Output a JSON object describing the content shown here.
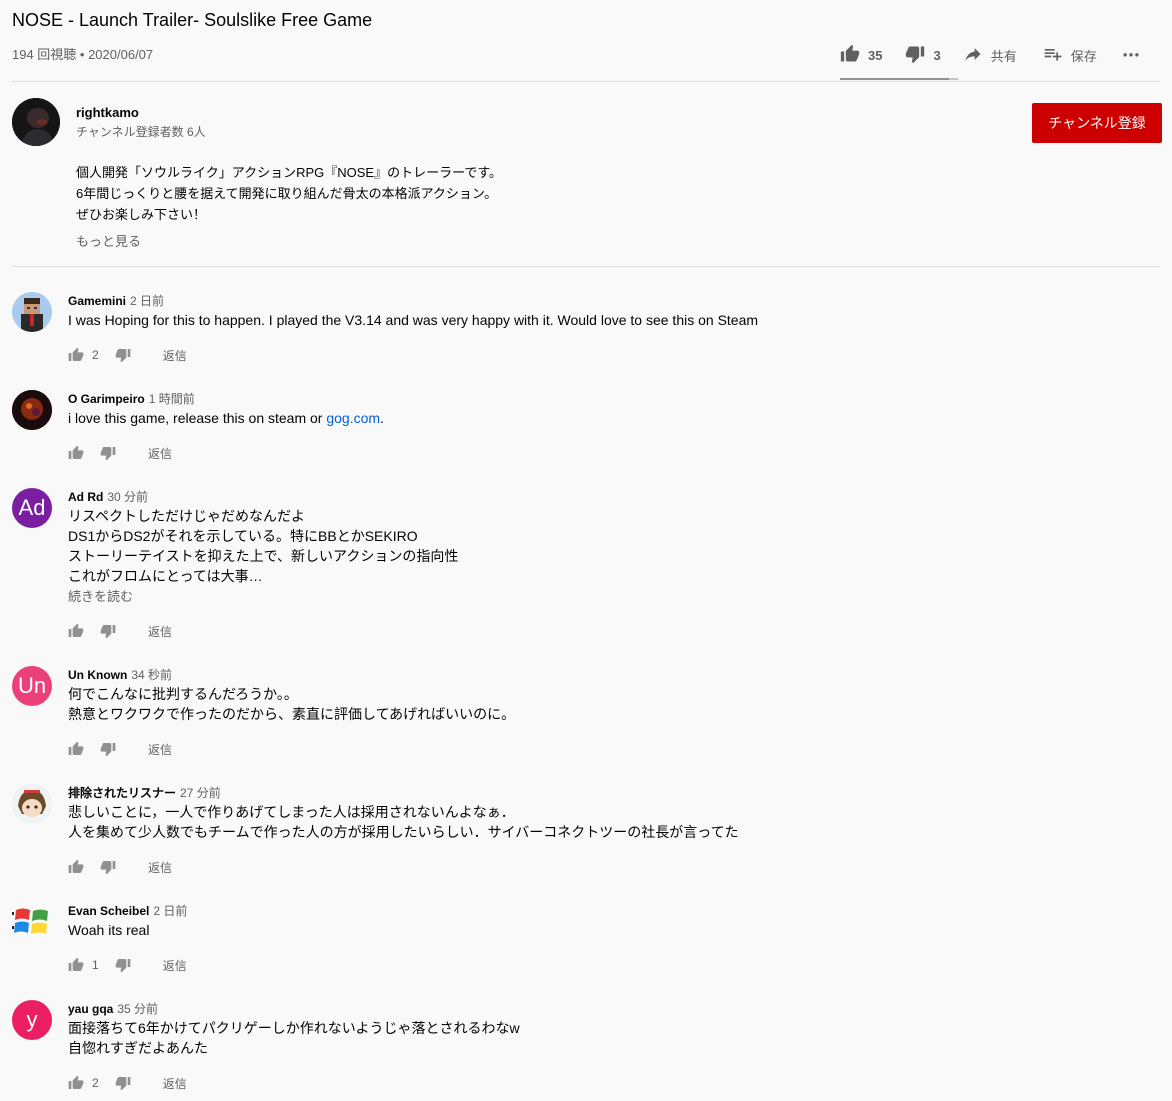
{
  "video": {
    "title": "NOSE - Launch Trailer- Soulslike Free Game",
    "meta": "194 回視聴 • 2020/06/07",
    "likes": "35",
    "dislikes": "3",
    "share_label": "共有",
    "save_label": "保存",
    "like_ratio": 0.92
  },
  "channel": {
    "name": "rightkamo",
    "subscribers": "チャンネル登録者数 6人",
    "subscribe_label": "チャンネル登録",
    "description": [
      "個人開発「ソウルライク」アクションRPG『NOSE』のトレーラーです。",
      "6年間じっくりと腰を据えて開発に取り組んだ骨太の本格派アクション。",
      "ぜひお楽しみ下さい！"
    ],
    "show_more": "もっと見る"
  },
  "reply_label": "返信",
  "comments": [
    {
      "author": "Gamemini",
      "time": "2 日前",
      "lines": [
        "I was Hoping for this to happen. I played the V3.14 and was very happy with it. Would love to see this on Steam"
      ],
      "likes": "2"
    },
    {
      "author": "O Garimpeiro",
      "time": "1 時間前",
      "text_pre": "i love this game, release this on steam or ",
      "link": "gog.com",
      "text_post": ".",
      "likes": ""
    },
    {
      "author": "Ad Rd",
      "time": "30 分前",
      "initial": "Ad",
      "avatar_color": "#7b1fa2",
      "lines": [
        "リスペクトしただけじゃだめなんだよ",
        "DS1からDS2がそれを示している。特にBBとかSEKIRO",
        "ストーリーテイストを抑えた上で、新しいアクションの指向性",
        "これがフロムにとっては大事…"
      ],
      "read_more": "続きを読む",
      "likes": ""
    },
    {
      "author": "Un Known",
      "time": "34 秒前",
      "initial": "Un",
      "avatar_color": "#ec407a",
      "lines": [
        "何でこんなに批判するんだろうか。。",
        "熱意とワクワクで作ったのだから、素直に評価してあげればいいのに。"
      ],
      "likes": ""
    },
    {
      "author": "排除されたリスナー",
      "time": "27 分前",
      "lines": [
        "悲しいことに，一人で作りあげてしまった人は採用されないんよなぁ．",
        "人を集めて少人数でもチームで作った人の方が採用したいらしい．サイバーコネクトツーの社長が言ってた"
      ],
      "likes": ""
    },
    {
      "author": "Evan Scheibel",
      "time": "2 日前",
      "lines": [
        "Woah its real"
      ],
      "likes": "1"
    },
    {
      "author": "yau gqa",
      "time": "35 分前",
      "initial": "y",
      "avatar_color": "#e91e63",
      "lines": [
        "面接落ちて6年かけてパクリゲーしか作れないようじゃ落とされるわなw",
        "自惚れすぎだよあんた"
      ],
      "likes": "2"
    }
  ]
}
